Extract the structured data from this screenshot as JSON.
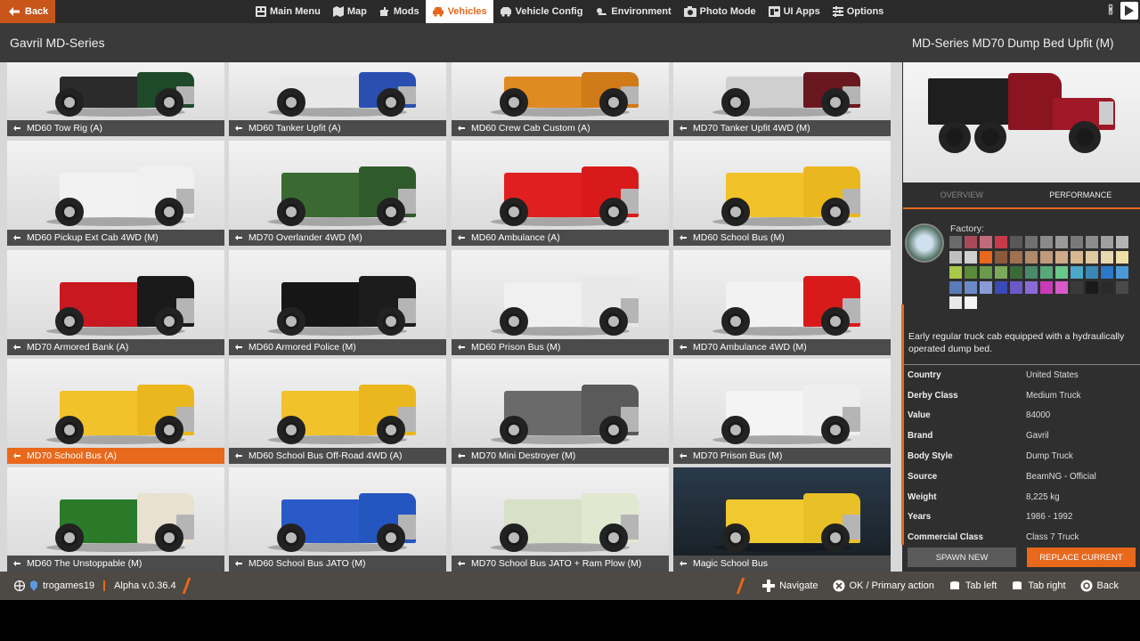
{
  "topbar": {
    "back_label": "Back",
    "nav": [
      {
        "label": "Main Menu",
        "icon": "main-menu-icon"
      },
      {
        "label": "Map",
        "icon": "map-icon"
      },
      {
        "label": "Mods",
        "icon": "mods-icon"
      },
      {
        "label": "Vehicles",
        "icon": "vehicles-icon",
        "active": true
      },
      {
        "label": "Vehicle Config",
        "icon": "vehicle-config-icon"
      },
      {
        "label": "Environment",
        "icon": "environment-icon"
      },
      {
        "label": "Photo Mode",
        "icon": "camera-icon"
      },
      {
        "label": "UI Apps",
        "icon": "ui-apps-icon"
      },
      {
        "label": "Options",
        "icon": "options-icon"
      }
    ]
  },
  "title": "Gavril MD-Series",
  "vehicles": [
    {
      "name": "MD60 Tow Rig (A)",
      "body": "#2b2b2b",
      "cab": "#1f4a2a"
    },
    {
      "name": "MD60 Tanker Upfit (A)",
      "body": "#e8e8e8",
      "cab": "#2a4fb0"
    },
    {
      "name": "MD60 Crew Cab Custom (A)",
      "body": "#e08a22",
      "cab": "#d07a18"
    },
    {
      "name": "MD70 Tanker Upfit 4WD (M)",
      "body": "#cfcfcf",
      "cab": "#6a1820"
    },
    {
      "name": "MD60 Pickup Ext Cab 4WD (M)",
      "body": "#f2f2f2",
      "cab": "#f0f0f0"
    },
    {
      "name": "MD70 Overlander 4WD (M)",
      "body": "#3a6a32",
      "cab": "#2f5a2a"
    },
    {
      "name": "MD60 Ambulance (A)",
      "body": "#e02020",
      "cab": "#d81a1a"
    },
    {
      "name": "MD60 School Bus (M)",
      "body": "#f2c22a",
      "cab": "#eab81e"
    },
    {
      "name": "MD70 Armored Bank (A)",
      "body": "#c81820",
      "cab": "#1a1a1a"
    },
    {
      "name": "MD60 Armored Police (M)",
      "body": "#161616",
      "cab": "#1c1c1c"
    },
    {
      "name": "MD60 Prison Bus (M)",
      "body": "#f0f0f0",
      "cab": "#e8e8e8"
    },
    {
      "name": "MD70 Ambulance 4WD (M)",
      "body": "#f2f2f2",
      "cab": "#d81a1a"
    },
    {
      "name": "MD70 School Bus (A)",
      "body": "#f2c22a",
      "cab": "#eab81e",
      "selected": true
    },
    {
      "name": "MD60 School Bus Off-Road 4WD (A)",
      "body": "#f2c22a",
      "cab": "#eab81e"
    },
    {
      "name": "MD70 Mini Destroyer (M)",
      "body": "#6a6a6a",
      "cab": "#5a5a5a"
    },
    {
      "name": "MD70 Prison Bus (M)",
      "body": "#f4f4f4",
      "cab": "#eeeeee"
    },
    {
      "name": "MD60 The Unstoppable (M)",
      "body": "#2a7a2a",
      "cab": "#e8e0d0"
    },
    {
      "name": "MD60 School Bus JATO (M)",
      "body": "#2a5ac8",
      "cab": "#2456c0"
    },
    {
      "name": "MD70 School Bus JATO + Ram Plow (M)",
      "body": "#d8e0c8",
      "cab": "#e0e8d0"
    },
    {
      "name": "Magic School Bus",
      "body": "#f0c830",
      "cab": "#e8c028",
      "dark": true
    }
  ],
  "panel": {
    "title": "MD-Series MD70 Dump Bed Upfit (M)",
    "tabs": [
      "OVERVIEW",
      "PERFORMANCE"
    ],
    "factory_label": "Factory:",
    "paints": [
      "#6a6a6a",
      "#a84a5a",
      "#c06a7a",
      "#c83a4a",
      "#585858",
      "#707070",
      "#8a8a8a",
      "#9a9a9a",
      "#7a7a7a",
      "#8c8c8c",
      "#a0a0a0",
      "#b4b4b4",
      "#c0c0c0",
      "#d0d0d0",
      "#e8681c",
      "#8a5a3a",
      "#a07050",
      "#b08a6a",
      "#c09a7a",
      "#d0aa8a",
      "#d8b890",
      "#e0c8a0",
      "#e8d8b0",
      "#f0e0a8",
      "#a8c848",
      "#5a8a3a",
      "#6a9a4a",
      "#7aaa5a",
      "#3a6a3a",
      "#4a8a6a",
      "#5aa87a",
      "#6ac88a",
      "#4aa8c8",
      "#3a88b8",
      "#2a78c8",
      "#4a98d8",
      "#5a7ab8",
      "#6a8ac8",
      "#8a9ad8",
      "#3a4ab8",
      "#6a5ac8",
      "#8a6ad8",
      "#c83ab8",
      "#d85ac8",
      "#3a3a3a",
      "#1a1a1a",
      "#2a2a2a",
      "#4a4a4a",
      "#e8e8e8",
      "#f4f4f4"
    ],
    "description": "Early regular truck cab equipped with a hydraulically operated dump bed.",
    "specs": [
      {
        "key": "Country",
        "value": "United States"
      },
      {
        "key": "Derby Class",
        "value": "Medium Truck"
      },
      {
        "key": "Value",
        "value": "84000"
      },
      {
        "key": "Brand",
        "value": "Gavril"
      },
      {
        "key": "Body Style",
        "value": "Dump Truck"
      },
      {
        "key": "Source",
        "value": "BeamNG - Official"
      },
      {
        "key": "Weight",
        "value": "8,225 kg"
      },
      {
        "key": "Years",
        "value": "1986 - 1992"
      },
      {
        "key": "Commercial Class",
        "value": "Class 7 Truck"
      }
    ],
    "spawn_label": "SPAWN NEW",
    "replace_label": "REPLACE CURRENT"
  },
  "bottombar": {
    "username": "trogames19",
    "version": "Alpha v.0.36.4",
    "hints": [
      {
        "label": "Navigate",
        "icon": "dpad-icon"
      },
      {
        "label": "OK / Primary action",
        "icon": "x-button-icon"
      },
      {
        "label": "Tab left",
        "icon": "bumper-left-icon"
      },
      {
        "label": "Tab right",
        "icon": "bumper-right-icon"
      },
      {
        "label": "Back",
        "icon": "circle-button-icon"
      }
    ]
  }
}
